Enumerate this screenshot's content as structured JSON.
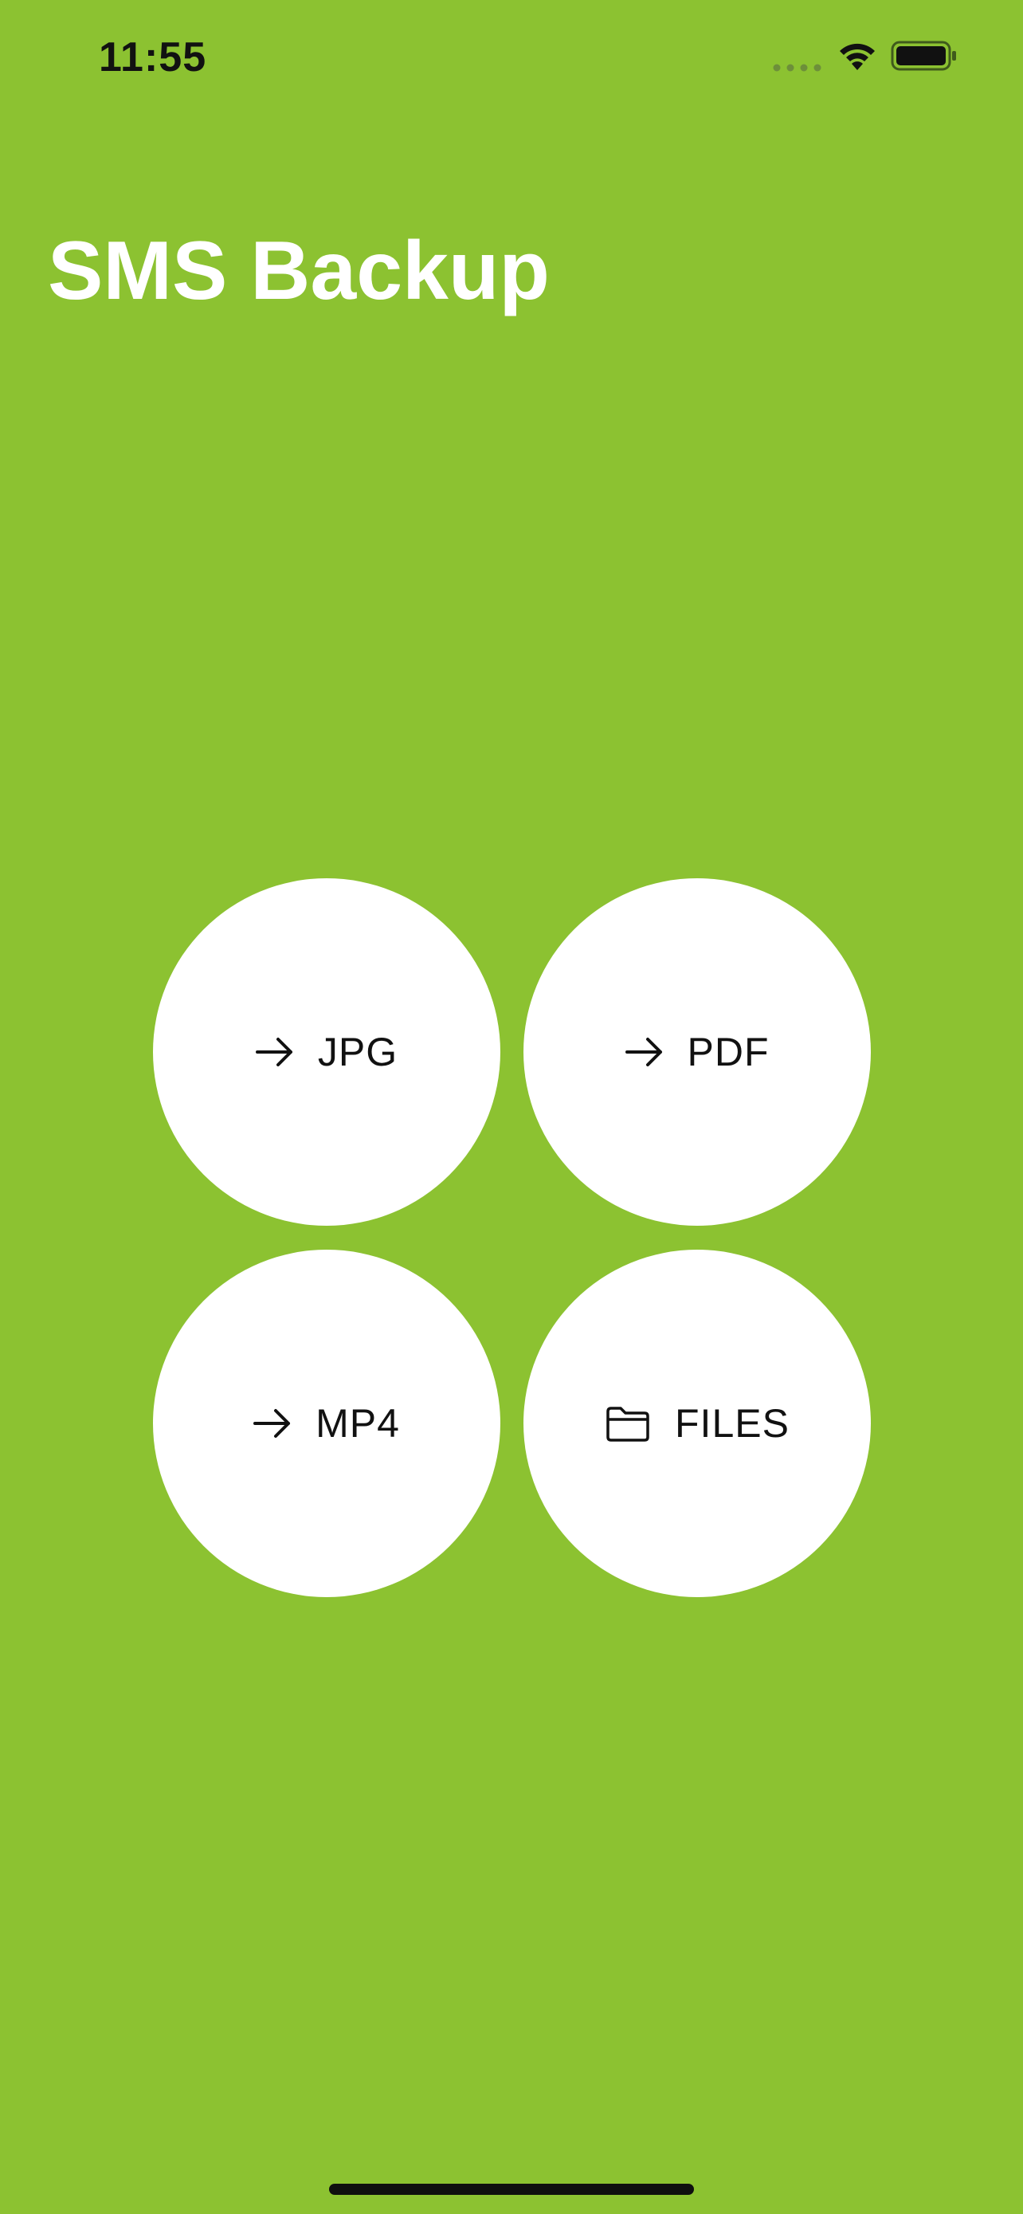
{
  "status_bar": {
    "time": "11:55",
    "icons": [
      "signal-dots-icon",
      "wifi-icon",
      "battery-icon"
    ]
  },
  "header": {
    "title": "SMS Backup"
  },
  "actions": {
    "jpg": {
      "label": "JPG",
      "icon": "arrow-right-icon"
    },
    "pdf": {
      "label": "PDF",
      "icon": "arrow-right-icon"
    },
    "mp4": {
      "label": "MP4",
      "icon": "arrow-right-icon"
    },
    "files": {
      "label": "FILES",
      "icon": "folder-icon"
    }
  },
  "colors": {
    "background": "#8cc231",
    "button": "#ffffff",
    "text": "#111111",
    "title": "#ffffff"
  }
}
